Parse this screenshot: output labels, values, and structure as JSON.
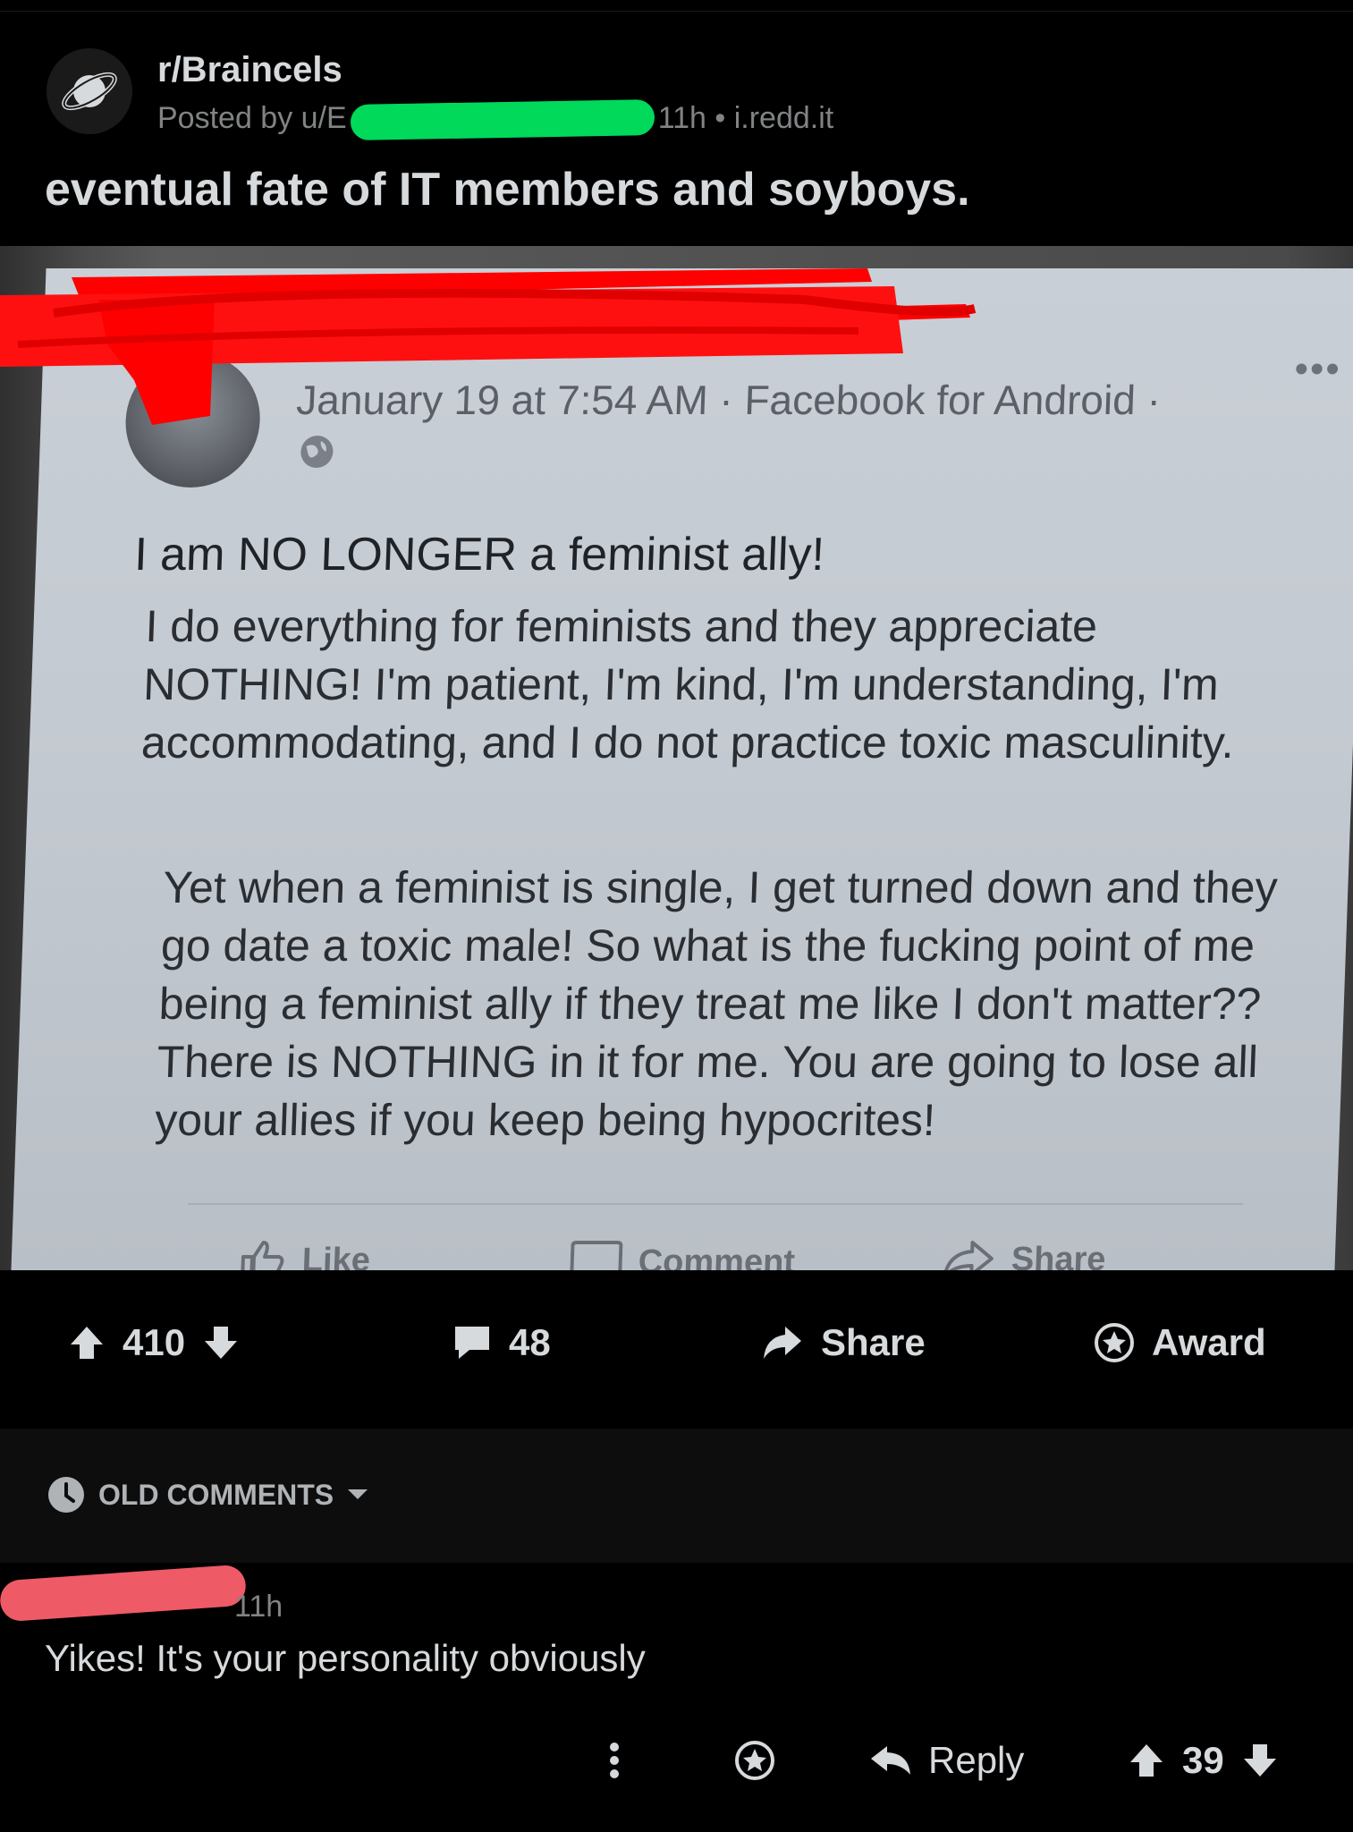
{
  "post": {
    "subreddit": "r/Braincels",
    "posted_by_prefix": "Posted by u/E",
    "time": "11h",
    "separator": "•",
    "domain": "i.redd.it",
    "title": "eventual fate of IT members and soyboys."
  },
  "facebook_post": {
    "date_line": "January 19 at 7:54 AM · Facebook for Android ·",
    "headline": "I am NO LONGER a feminist ally!",
    "paragraph1": "I do everything for feminists and they appreciate NOTHING! I'm patient, I'm kind, I'm understanding, I'm accommodating, and I do not practice toxic masculinity.",
    "paragraph2": "Yet when a feminist is single, I get turned down and they go date a toxic male! So what is the fucking point of me being a feminist ally if they treat me like I don't matter?? There is NOTHING in it for me. You are going to lose all your allies if you keep being hypocrites!",
    "actions": {
      "like": "Like",
      "comment": "Comment",
      "share": "Share"
    },
    "more": "•••"
  },
  "post_actions": {
    "score": "410",
    "comments": "48",
    "share": "Share",
    "award": "Award"
  },
  "comments_sort": {
    "label": "OLD COMMENTS"
  },
  "comment": {
    "time": "11h",
    "text": "Yikes! It's your personality obviously",
    "reply": "Reply",
    "score": "39"
  },
  "colors": {
    "background": "#000000",
    "text": "#d7dadc",
    "muted": "#818384",
    "redaction_green": "#00d95a",
    "redaction_red": "#ff0000",
    "redaction_pink": "#ee5a66"
  }
}
